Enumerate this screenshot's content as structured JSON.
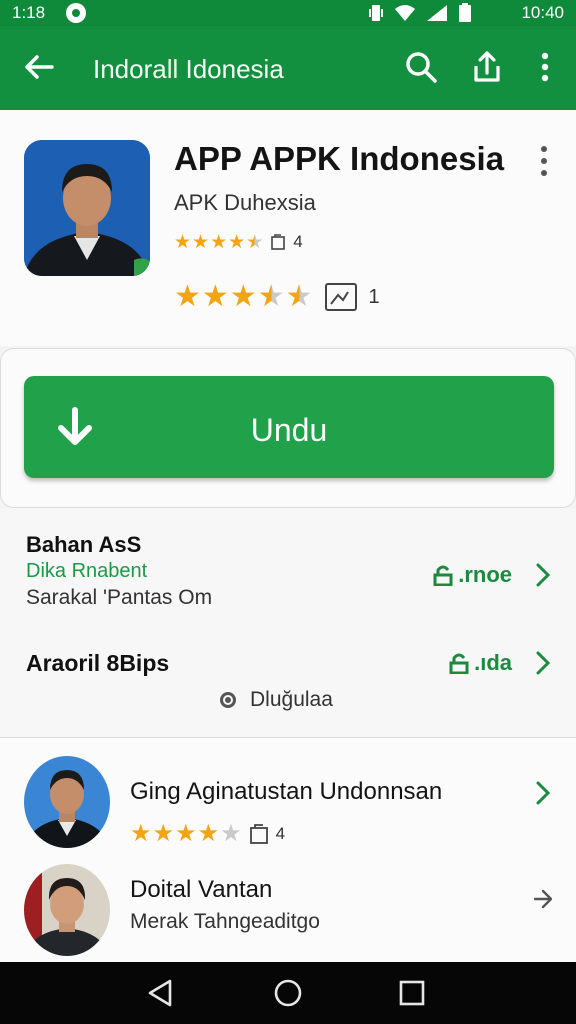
{
  "status_bar": {
    "time_left": "1:18",
    "time_right": "10:40"
  },
  "toolbar": {
    "title": "Indorall Idonesia"
  },
  "app": {
    "title": "APP APPK Indonesia",
    "developer": "APK Duhexsia",
    "rating_small_count": "4",
    "rating_small_stars": 4.5,
    "rating_big_count": "1",
    "rating_big_stars": 3.5
  },
  "install": {
    "label": "Undu"
  },
  "info": {
    "heading": "Bahan AsS",
    "subheading": "Dika Rnabent",
    "detail": "Sarakal 'Pantas Om",
    "action1": ".rnoe",
    "row2_label": "Araoril 8Bips",
    "action2": ".ıda",
    "radio_label": "Dluğulaa"
  },
  "related": [
    {
      "title": "Ging Aginatustan Undonnsan",
      "rating_count": "4",
      "stars": 4
    },
    {
      "title": "Doital Vantan",
      "subtitle": "Merak Tahngeaditgo"
    }
  ],
  "colors": {
    "primary": "#12903f",
    "accent": "#21a24a",
    "star": "#f3a412"
  }
}
